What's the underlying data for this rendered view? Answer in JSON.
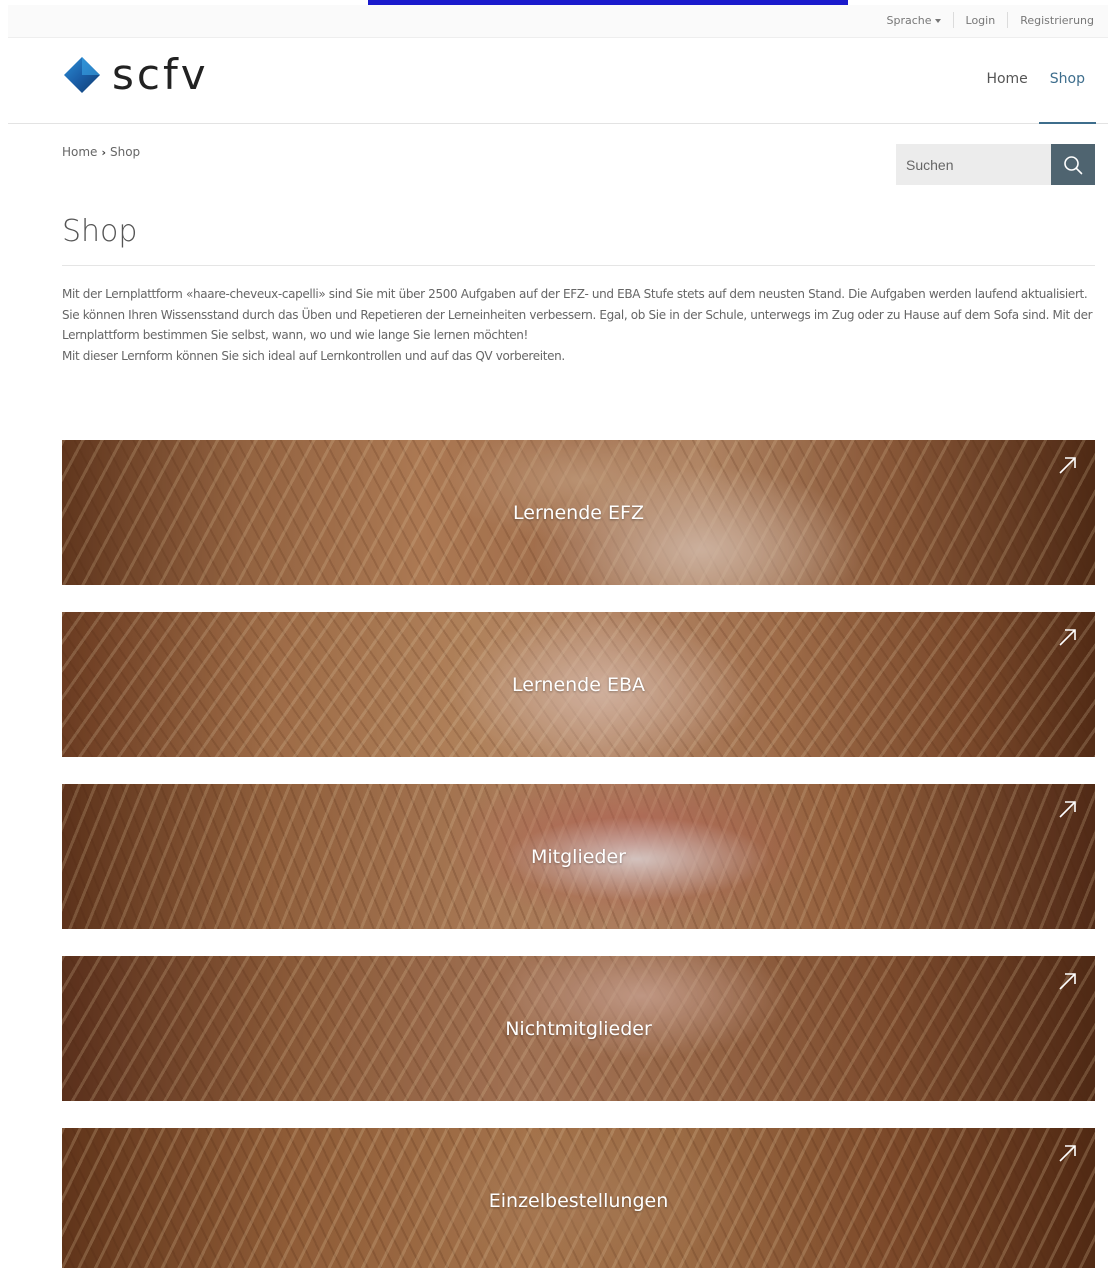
{
  "utility_nav": {
    "language": "Sprache",
    "login": "Login",
    "register": "Registrierung"
  },
  "brand": {
    "name": "scfv",
    "accent_color": "#1e4f8a"
  },
  "main_nav": {
    "items": [
      {
        "label": "Home"
      },
      {
        "label": "Shop"
      }
    ],
    "active_color": "#3d6d8c"
  },
  "breadcrumb": {
    "home": "Home",
    "current": "Shop"
  },
  "search": {
    "placeholder": "Suchen",
    "icon": "search-icon"
  },
  "page": {
    "title": "Shop",
    "intro": [
      "Mit der Lernplattform «haare-cheveux-capelli» sind Sie mit über 2500 Aufgaben auf der EFZ- und EBA Stufe stets auf dem neusten Stand. Die Aufgaben werden laufend aktualisiert.",
      "Sie können Ihren Wissensstand durch das Üben und Repetieren der Lerneinheiten verbessern. Egal, ob Sie in der Schule, unterwegs im Zug oder zu Hause auf dem Sofa sind. Mit der Lernplattform bestimmen Sie selbst, wann, wo und wie lange Sie lernen möchten!",
      "Mit dieser Lernform können Sie sich ideal auf Lernkontrollen und auf das QV vorbereiten."
    ]
  },
  "tiles": [
    {
      "label": "Lernende EFZ",
      "icon": "arrow-up-right-icon"
    },
    {
      "label": "Lernende EBA",
      "icon": "arrow-up-right-icon"
    },
    {
      "label": "Mitglieder",
      "icon": "arrow-up-right-icon"
    },
    {
      "label": "Nichtmitglieder",
      "icon": "arrow-up-right-icon"
    },
    {
      "label": "Einzelbestellungen",
      "icon": "arrow-up-right-icon"
    }
  ]
}
